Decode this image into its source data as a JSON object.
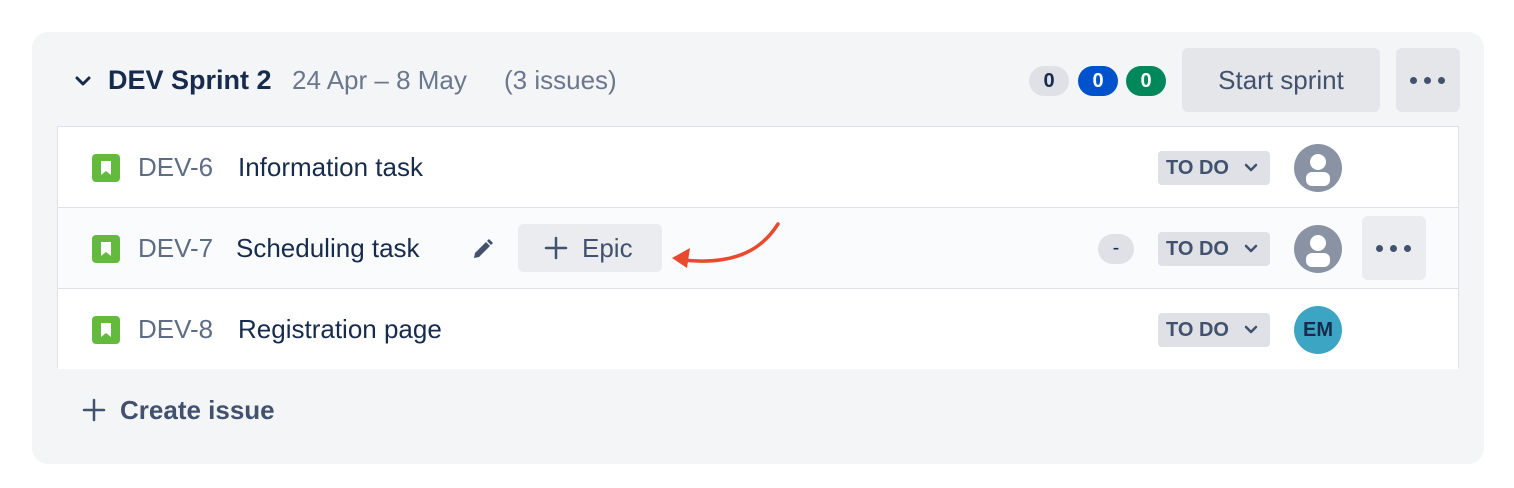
{
  "sprint": {
    "name": "DEV Sprint 2",
    "dates": "24 Apr – 8 May",
    "issue_count": "(3 issues)",
    "counts": {
      "todo": "0",
      "in_progress": "0",
      "done": "0"
    },
    "start_label": "Start sprint",
    "more_icon": "ellipsis-icon",
    "chevron_icon": "chevron-down-icon"
  },
  "issues": [
    {
      "key": "DEV-6",
      "summary": "Information task",
      "status": "TO DO",
      "type_icon": "story-icon",
      "assignee": "unassigned"
    },
    {
      "key": "DEV-7",
      "summary": "Scheduling task",
      "status": "TO DO",
      "type_icon": "story-icon",
      "assignee": "unassigned",
      "epic_label": "Epic",
      "estimate": "-",
      "edit_icon": "pencil-icon"
    },
    {
      "key": "DEV-8",
      "summary": "Registration page",
      "status": "TO DO",
      "type_icon": "story-icon",
      "assignee_initials": "EM"
    }
  ],
  "create_issue_label": "Create issue",
  "colors": {
    "panel_bg": "#f4f5f7",
    "todo_badge": "#dfe1e6",
    "in_progress_badge": "#0052cc",
    "done_badge": "#00875a",
    "story_icon": "#63ba3c",
    "avatar_em": "#3da5c4",
    "annotation_arrow": "#e8492f"
  }
}
